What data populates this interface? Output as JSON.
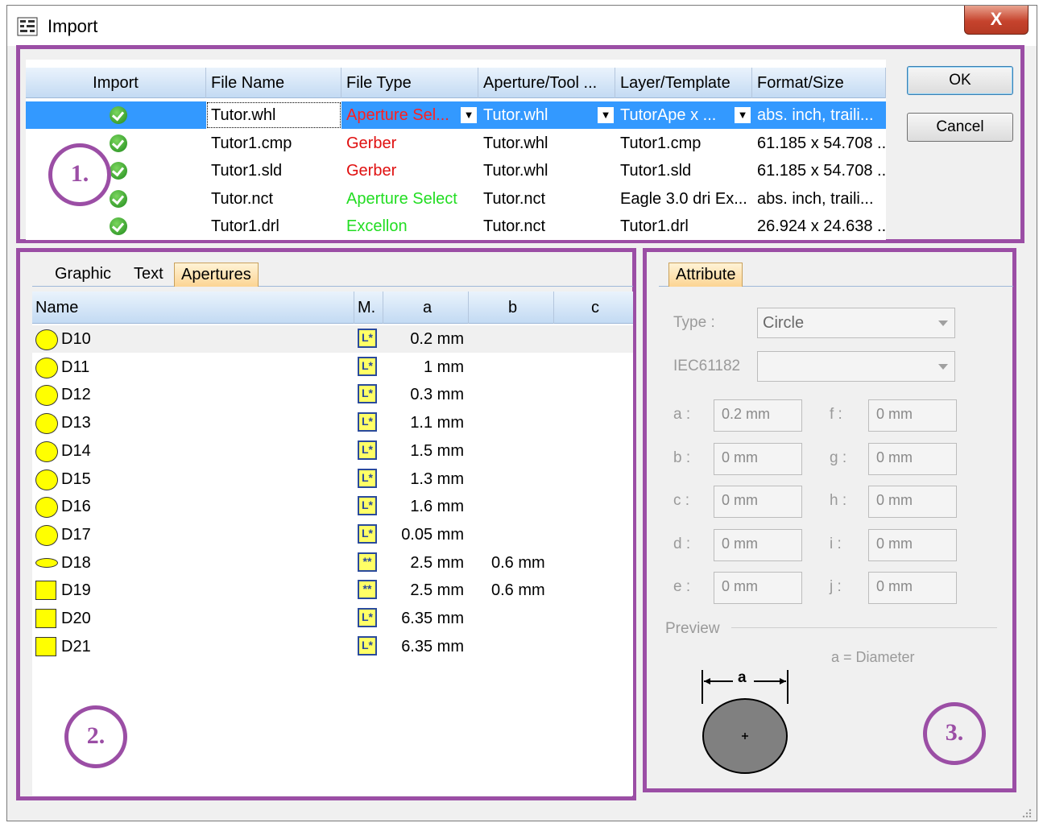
{
  "window": {
    "title": "Import",
    "close_label": "X"
  },
  "import_table": {
    "headers": [
      "Import",
      "File Name",
      "File Type",
      "Aperture/Tool ...",
      "Layer/Template",
      "Format/Size"
    ],
    "rows": [
      {
        "file_name": "Tutor.whl",
        "file_type": "Aperture Sel...",
        "file_type_color": "#ff2020",
        "aperture": "Tutor.whl",
        "layer": "TutorApe x ...",
        "format": "abs. inch, traili..."
      },
      {
        "file_name": "Tutor1.cmp",
        "file_type": "Gerber",
        "file_type_color": "#e01010",
        "aperture": "Tutor.whl",
        "layer": "Tutor1.cmp",
        "format": "61.185 x 54.708 ..."
      },
      {
        "file_name": "Tutor1.sld",
        "file_type": "Gerber",
        "file_type_color": "#e01010",
        "aperture": "Tutor.whl",
        "layer": "Tutor1.sld",
        "format": "61.185 x 54.708 ..."
      },
      {
        "file_name": "Tutor.nct",
        "file_type": "Aperture Select",
        "file_type_color": "#22dd22",
        "aperture": "Tutor.nct",
        "layer": "Eagle 3.0 dri Ex...",
        "format": "abs. inch, traili..."
      },
      {
        "file_name": "Tutor1.drl",
        "file_type": "Excellon",
        "file_type_color": "#22dd22",
        "aperture": "Tutor.nct",
        "layer": "Tutor1.drl",
        "format": "26.924 x 24.638 ..."
      }
    ]
  },
  "buttons": {
    "ok": "OK",
    "cancel": "Cancel"
  },
  "annotations": {
    "one": "1.",
    "two": "2.",
    "three": "3."
  },
  "left_tabs": [
    "Graphic",
    "Text",
    "Apertures"
  ],
  "aperture_table": {
    "headers": [
      "Name",
      "M.",
      "a",
      "b",
      "c"
    ],
    "rows": [
      {
        "shape": "circle",
        "name": "D10",
        "a": "0.2 mm",
        "b": "",
        "m": "L*"
      },
      {
        "shape": "circle",
        "name": "D11",
        "a": "1 mm",
        "b": "",
        "m": "L*"
      },
      {
        "shape": "circle",
        "name": "D12",
        "a": "0.3 mm",
        "b": "",
        "m": "L*"
      },
      {
        "shape": "circle",
        "name": "D13",
        "a": "1.1 mm",
        "b": "",
        "m": "L*"
      },
      {
        "shape": "circle",
        "name": "D14",
        "a": "1.5 mm",
        "b": "",
        "m": "L*"
      },
      {
        "shape": "circle",
        "name": "D15",
        "a": "1.3 mm",
        "b": "",
        "m": "L*"
      },
      {
        "shape": "circle",
        "name": "D16",
        "a": "1.6 mm",
        "b": "",
        "m": "L*"
      },
      {
        "shape": "circle",
        "name": "D17",
        "a": "0.05 mm",
        "b": "",
        "m": "L*"
      },
      {
        "shape": "oval",
        "name": "D18",
        "a": "2.5 mm",
        "b": "0.6 mm",
        "m": "**"
      },
      {
        "shape": "square",
        "name": "D19",
        "a": "2.5 mm",
        "b": "0.6 mm",
        "m": "**"
      },
      {
        "shape": "square",
        "name": "D20",
        "a": "6.35 mm",
        "b": "",
        "m": "L*"
      },
      {
        "shape": "square",
        "name": "D21",
        "a": "6.35 mm",
        "b": "",
        "m": "L*"
      }
    ]
  },
  "attribute": {
    "tab": "Attribute",
    "type_label": "Type :",
    "type_value": "Circle",
    "iec_label": "IEC61182",
    "iec_value": "",
    "fields_left": [
      {
        "label": "a :",
        "value": "0.2 mm"
      },
      {
        "label": "b :",
        "value": "0 mm"
      },
      {
        "label": "c :",
        "value": "0 mm"
      },
      {
        "label": "d :",
        "value": "0 mm"
      },
      {
        "label": "e :",
        "value": "0 mm"
      }
    ],
    "fields_right": [
      {
        "label": "f :",
        "value": "0 mm"
      },
      {
        "label": "g :",
        "value": "0 mm"
      },
      {
        "label": "h :",
        "value": "0 mm"
      },
      {
        "label": "i :",
        "value": "0 mm"
      },
      {
        "label": "j :",
        "value": "0 mm"
      }
    ],
    "preview_label": "Preview",
    "preview_caption": "a = Diameter",
    "dim_label": "a"
  }
}
